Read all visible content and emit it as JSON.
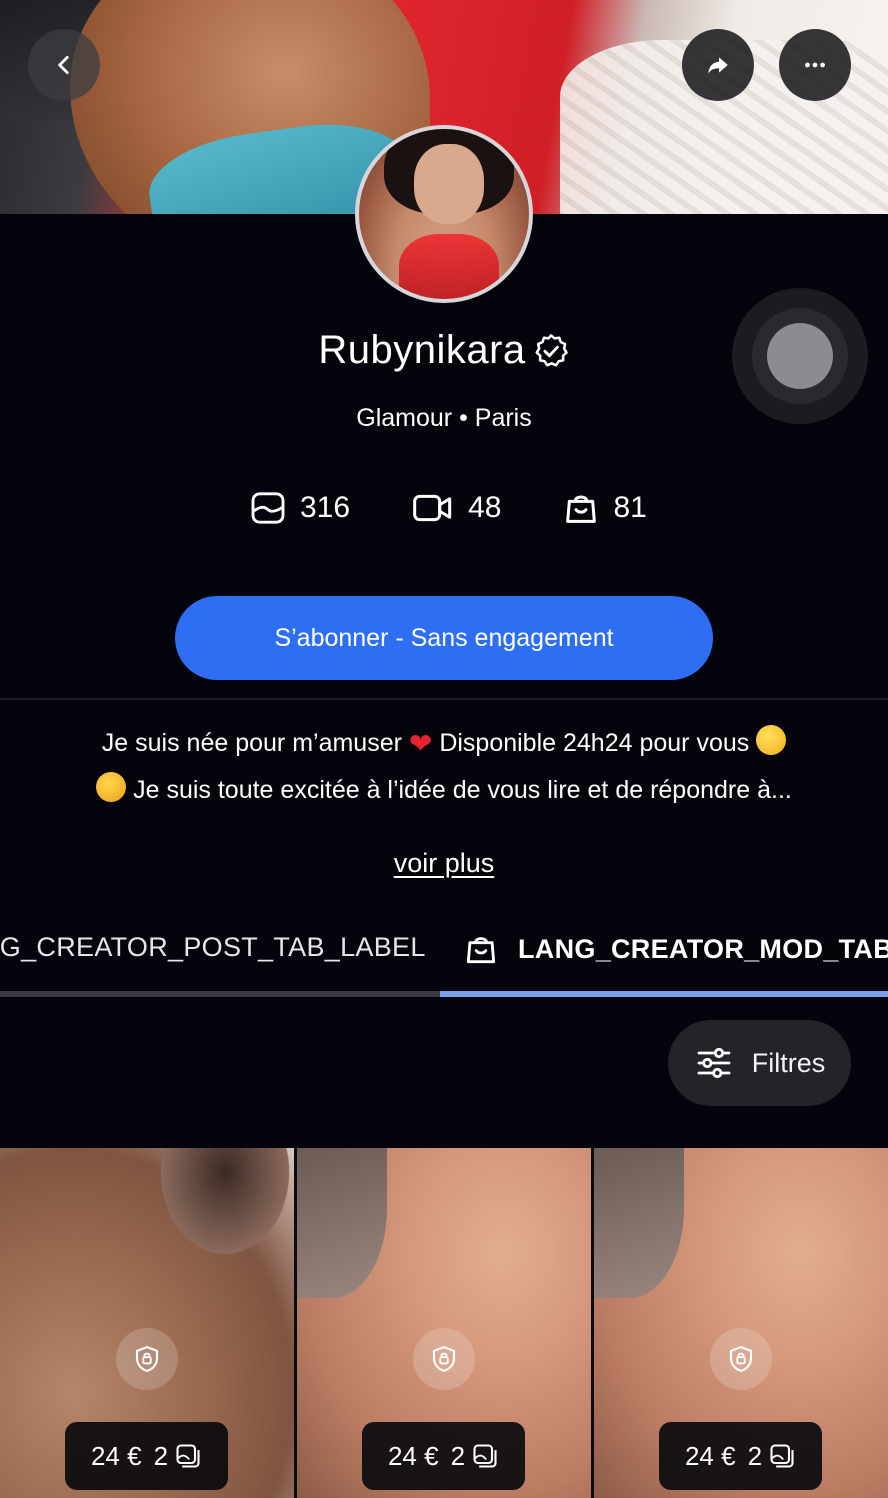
{
  "profile": {
    "name": "Rubynikara",
    "subtitle": "Glamour • Paris",
    "verified": true
  },
  "stats": [
    {
      "icon": "photo-icon",
      "value": "316"
    },
    {
      "icon": "video-icon",
      "value": "48"
    },
    {
      "icon": "bag-icon",
      "value": "81"
    }
  ],
  "subscribe_label": "S’abonner - Sans engagement",
  "bio": {
    "line1_a": "Je suis née pour m’amuser",
    "line1_b": "Disponible 24h24 pour vous",
    "line2": "Je suis toute excitée à l’idée de vous lire et de répondre à...",
    "more": "voir plus"
  },
  "tabs": {
    "post": "NG_CREATOR_POST_TAB_LABEL",
    "mod": "LANG_CREATOR_MOD_TAB"
  },
  "filters_label": "Filtres",
  "items": [
    {
      "price": "24 €",
      "count": "2"
    },
    {
      "price": "24 €",
      "count": "2"
    },
    {
      "price": "24 €",
      "count": "2"
    }
  ],
  "colors": {
    "background": "#03040c",
    "accent": "#2d6ef2",
    "tab_active": "#7aa0ee"
  }
}
